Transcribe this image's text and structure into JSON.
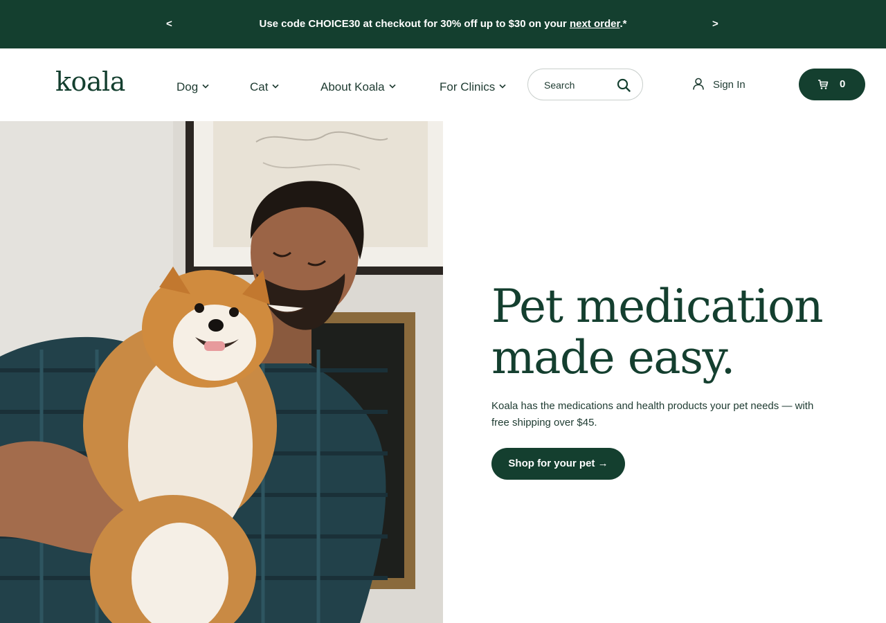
{
  "promo": {
    "prev_label": "<",
    "next_label": ">",
    "message_prefix": "Use code CHOICE30 at checkout for 30% off up to $30 on your ",
    "message_link": "next order",
    "message_suffix": ".*"
  },
  "header": {
    "logo": "koala",
    "nav": {
      "dog": "Dog",
      "cat": "Cat",
      "about": "About Koala",
      "clinics": "For Clinics"
    },
    "search_placeholder": "Search",
    "sign_in": "Sign In",
    "cart_count": "0"
  },
  "hero": {
    "title_line1": "Pet medication",
    "title_line2": "made easy.",
    "subtitle": "Koala has the medications and health products your pet needs — with free shipping over $45.",
    "cta": "Shop for your pet →"
  },
  "colors": {
    "brand": "#143f2f",
    "text": "#1d3a30",
    "background": "#ffffff"
  },
  "icons": [
    "chevron-down-icon",
    "search-icon",
    "user-icon",
    "cart-icon"
  ]
}
